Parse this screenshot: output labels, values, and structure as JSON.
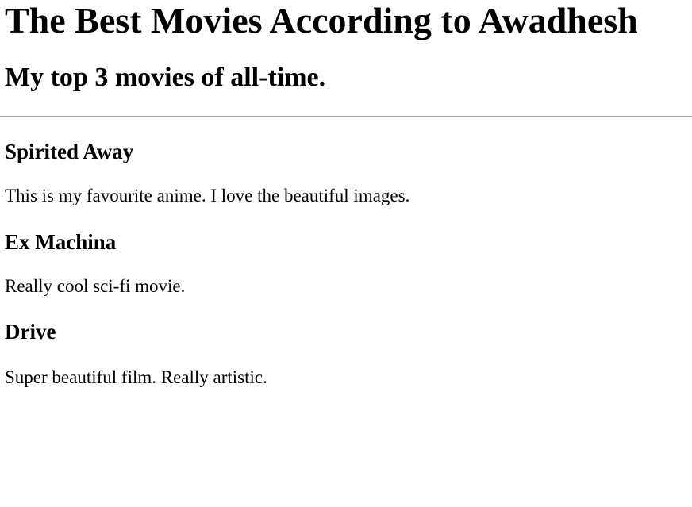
{
  "page": {
    "title": "The Best Movies According to Awadhesh",
    "subtitle": "My top 3 movies of all-time."
  },
  "movies": [
    {
      "name": "Spirited Away",
      "description": "This is my favourite anime. I love the beautiful images."
    },
    {
      "name": "Ex Machina",
      "description": "Really cool sci-fi movie."
    },
    {
      "name": "Drive",
      "description": "Super beautiful film. Really artistic."
    }
  ]
}
